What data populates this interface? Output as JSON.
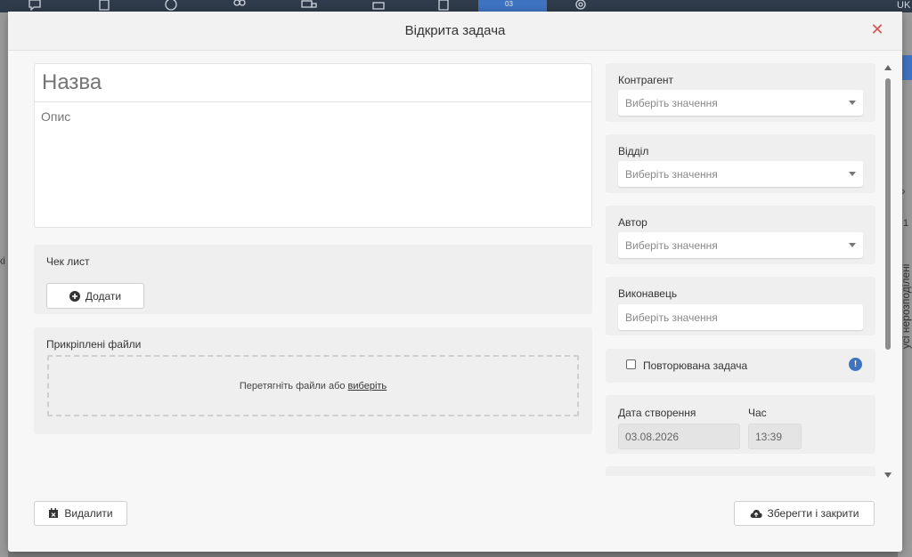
{
  "background": {
    "language": "UK",
    "right_vertical_text": "усі нерозподілені",
    "right_count": "1",
    "left_fragment": "кі",
    "active_nav_label": "03"
  },
  "modal": {
    "title": "Відкрита задача",
    "close_icon": "close-icon",
    "name_placeholder": "Назва",
    "description_placeholder": "Опис",
    "checklist": {
      "label": "Чек лист",
      "add_button": "Додати"
    },
    "attachments": {
      "label": "Прикріплені файли",
      "drop_text": "Перетягніть файли або",
      "choose_link": "виберіть"
    },
    "fields": {
      "counterparty": {
        "label": "Контрагент",
        "placeholder": "Виберіть значення"
      },
      "department": {
        "label": "Відділ",
        "placeholder": "Виберіть значення"
      },
      "author": {
        "label": "Автор",
        "placeholder": "Виберіть значення"
      },
      "assignee": {
        "label": "Виконавець",
        "placeholder": "Виберіть значення"
      },
      "recurring": {
        "label": "Повторювана задача",
        "checked": false
      },
      "created_date": {
        "label": "Дата створення",
        "value": "03.08.2026"
      },
      "time": {
        "label": "Час",
        "value": "13:39"
      }
    },
    "footer": {
      "delete_button": "Видалити",
      "save_close_button": "Зберегти і закрити"
    }
  },
  "colors": {
    "accent": "#3e73c2",
    "close": "#d9534f",
    "topbar": "#2f3b4a"
  }
}
